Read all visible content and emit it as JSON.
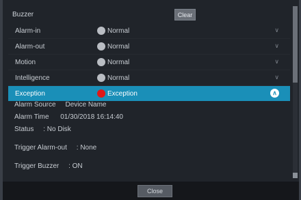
{
  "header": {
    "label": "Buzzer",
    "clear_label": "Clear"
  },
  "alarms": [
    {
      "label": "Alarm-in",
      "status": "Normal"
    },
    {
      "label": "Alarm-out",
      "status": "Normal"
    },
    {
      "label": "Motion",
      "status": "Normal"
    },
    {
      "label": "Intelligence",
      "status": "Normal"
    },
    {
      "label": "Exception",
      "status": "Exception"
    }
  ],
  "details": {
    "alarm_source": "Alarm Source     Device Name",
    "alarm_time": "Alarm Time      01/30/2018 16:14:40",
    "status": "Status     : No Disk",
    "trigger_alarm_out": "Trigger Alarm-out     : None",
    "trigger_buzzer": "Trigger Buzzer     : ON"
  },
  "footer": {
    "close_label": "Close"
  },
  "colors": {
    "selected_row": "#1a8fb8",
    "exception_dot": "#e01818",
    "normal_dot": "#b9bdc3"
  },
  "icons": {
    "row_chevron": "chevron-down-icon",
    "selected_chevron": "chevron-up-circle-icon"
  }
}
